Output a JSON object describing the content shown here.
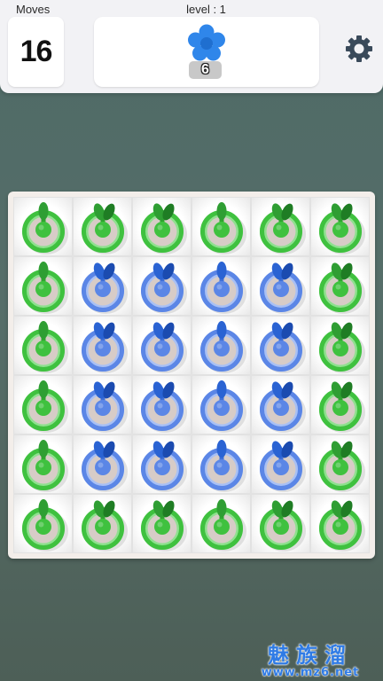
{
  "header": {
    "moves_label": "Moves",
    "moves_value": "16",
    "level_label": "level : 1",
    "goal": {
      "icon": "blue-flower-icon",
      "count": "6"
    },
    "settings_icon": "gear-icon"
  },
  "board": {
    "rows": 6,
    "cols": 6,
    "cells": [
      [
        "green",
        "green",
        "green",
        "green",
        "green",
        "green"
      ],
      [
        "green",
        "blue",
        "blue",
        "blue",
        "blue",
        "green"
      ],
      [
        "green",
        "blue",
        "blue",
        "blue",
        "blue",
        "green"
      ],
      [
        "green",
        "blue",
        "blue",
        "blue",
        "blue",
        "green"
      ],
      [
        "green",
        "blue",
        "blue",
        "blue",
        "blue",
        "green"
      ],
      [
        "green",
        "green",
        "green",
        "green",
        "green",
        "green"
      ]
    ],
    "colors": {
      "green": "#3fc13f",
      "blue": "#5b86e6"
    }
  },
  "watermark": {
    "text": "魅族溜",
    "url": "www.mz6.net"
  }
}
